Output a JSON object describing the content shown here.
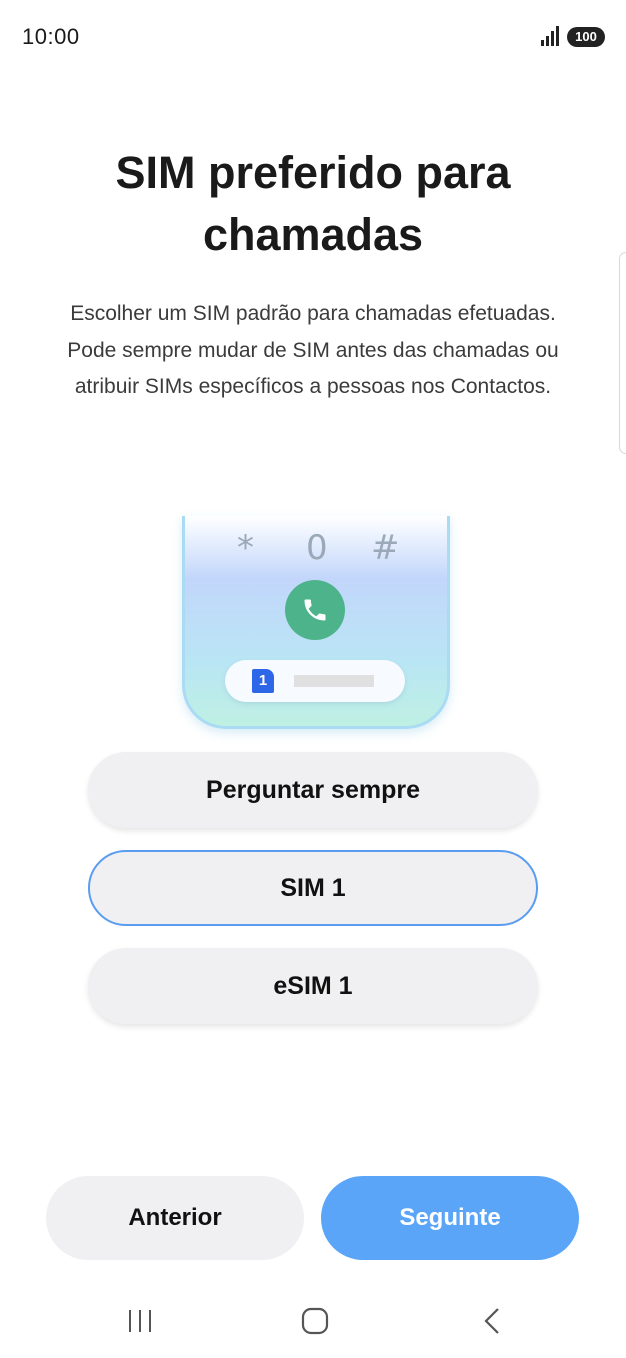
{
  "status_bar": {
    "time": "10:00",
    "battery": "100",
    "icons": [
      "signal-icon",
      "battery-icon"
    ]
  },
  "header": {
    "title": "SIM preferido para chamadas",
    "description": "Escolher um SIM padrão para chamadas efetuadas. Pode sempre mudar de SIM antes das chamadas ou atribuir SIMs específicos a pessoas nos Contactos."
  },
  "illustration": {
    "keys": [
      "*",
      "0",
      "#"
    ],
    "sim_number": "1",
    "icons": [
      "phone-call-icon",
      "sim-card-icon"
    ]
  },
  "options": [
    {
      "label": "Perguntar sempre",
      "selected": false
    },
    {
      "label": "SIM 1",
      "selected": true
    },
    {
      "label": "eSIM 1",
      "selected": false
    }
  ],
  "navigation": {
    "back_label": "Anterior",
    "next_label": "Seguinte"
  },
  "system_nav": {
    "icons": [
      "recents-icon",
      "home-icon",
      "back-icon"
    ]
  },
  "colors": {
    "accent": "#5aa5f8",
    "selected_border": "#5a9cf0",
    "call_green": "#4db38a",
    "sim_blue": "#2d67e8",
    "button_bg": "#f0f0f2"
  }
}
